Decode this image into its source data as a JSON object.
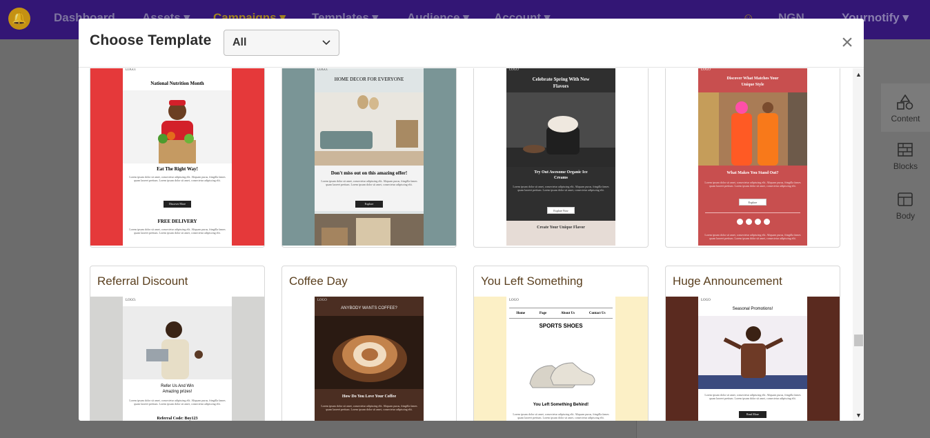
{
  "topnav": {
    "items": [
      {
        "label": "Dashboard",
        "active": false
      },
      {
        "label": "Assets ▾",
        "active": false
      },
      {
        "label": "Campaigns ▾",
        "active": true
      },
      {
        "label": "Templates ▾",
        "active": false
      },
      {
        "label": "Audience ▾",
        "active": false
      },
      {
        "label": "Account ▾",
        "active": false
      }
    ],
    "currency": "NGN",
    "user": "Yournotify ▾"
  },
  "sidebar": {
    "items": [
      {
        "label": "Content",
        "icon": "shapes-icon"
      },
      {
        "label": "Blocks",
        "icon": "blocks-icon"
      },
      {
        "label": "Body",
        "icon": "layout-icon"
      }
    ]
  },
  "modal": {
    "title": "Choose Template",
    "filter_value": "All",
    "close": "×"
  },
  "templates_row1": [
    {
      "bg": "#e5393a",
      "logo": "LOGO.",
      "heading": "National Nutrition Month",
      "subheading": "Eat The Right Way!",
      "button": "Discover More",
      "footer_heading": "FREE DELIVERY"
    },
    {
      "bg": "#7a9596",
      "logo": "LOGO.",
      "heading": "HOME DECOR FOR EVERYONE",
      "subheading": "Don't miss out on this amazing offer!",
      "button": "Explore"
    },
    {
      "bg": "#ffffff",
      "logo": "LOGO",
      "heading": "Celebrate Spring With New Flavors",
      "subheading": "Try Out Awesome Organic Ice Creams",
      "button": "Explore Now",
      "footer_heading": "Create Your Unique Flavor"
    },
    {
      "bg": "#ffffff",
      "logo": "LOGO",
      "heading": "Discover What Matches Your Unique Style",
      "subheading": "What Makes You Stand Out?",
      "button": "Explore"
    }
  ],
  "templates_row2": [
    {
      "name": "Referral Discount",
      "bg": "#d4d4d2",
      "logo": "LOGO.",
      "heading": "Refer Us And Win Amazing prizes!",
      "footer_heading": "Referral Code: Boy123"
    },
    {
      "name": "Coffee Day",
      "bg": "#ffffff",
      "logo": "LOGO",
      "heading": "ANYBODY WANTS COFFEE?",
      "subheading": "How Do You Love Your Coffee"
    },
    {
      "name": "You Left Something",
      "bg": "#fcf0c6",
      "logo": "LOGO",
      "nav": [
        "Home",
        "Page",
        "About Us",
        "Contact Us"
      ],
      "heading": "SPORTS SHOES",
      "subheading": "You Left Something Behind!"
    },
    {
      "name": "Huge Announcement",
      "bg": "#5a2a1f",
      "logo": "LOGO",
      "heading": "Seasonal Promotions!",
      "button": "Read More"
    }
  ],
  "lorem": "Lorem ipsum dolor sit amet, consectetur adipiscing elit. Aliquam purus, fringilla fames quam laoreet pretium. Lorem ipsum dolor sit amet, consectetur adipiscing elit."
}
